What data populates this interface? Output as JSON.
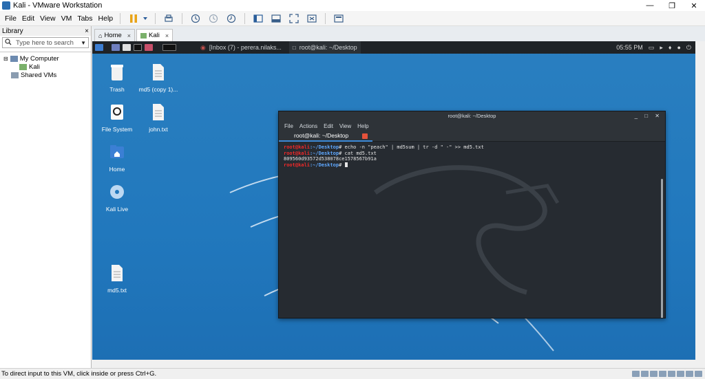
{
  "window": {
    "title": "Kali - VMware Workstation",
    "controls": [
      "—",
      "❐",
      "✕"
    ]
  },
  "menubar": {
    "items": [
      "File",
      "Edit",
      "View",
      "VM",
      "Tabs",
      "Help"
    ]
  },
  "library": {
    "title": "Library",
    "close": "×",
    "search_placeholder": "Type here to search",
    "tree": [
      {
        "label": "My Computer"
      },
      {
        "label": "Kali"
      },
      {
        "label": "Shared VMs"
      }
    ]
  },
  "tabs": [
    {
      "label": "Home",
      "close": "×"
    },
    {
      "label": "Kali",
      "close": "×"
    }
  ],
  "kali_panel": {
    "tasks": [
      "[Inbox (7) - perera.nilaks...",
      "root@kali: ~/Desktop"
    ],
    "clock": "05:55 PM"
  },
  "desktop_icons": [
    {
      "label": "Trash"
    },
    {
      "label": "md5 (copy 1)..."
    },
    {
      "label": "File System"
    },
    {
      "label": "john.txt"
    },
    {
      "label": "Home"
    },
    {
      "label": "Kali Live"
    },
    {
      "label": "md5.txt"
    }
  ],
  "terminal": {
    "title": "root@kali: ~/Desktop",
    "menu": [
      "File",
      "Actions",
      "Edit",
      "View",
      "Help"
    ],
    "tab_label": "root@kali: ~/Desktop",
    "prompt_user": "root@kali",
    "prompt_path": ":~/Desktop",
    "lines": [
      {
        "cmd": "# echo -n \"peach\" | md5sum | tr -d \" -\" >> md5.txt"
      },
      {
        "cmd": "# cat md5.txt"
      },
      {
        "output": "809560d93572d538078ce1578567b91a"
      },
      {
        "cmd": "# "
      }
    ]
  },
  "statusbar": {
    "text": "To direct input to this VM, click inside or press Ctrl+G."
  },
  "colors": {
    "desktop": "#2178bd",
    "terminal_bg": "#262b31",
    "prompt_user": "#ef2929",
    "prompt_path": "#5fa8ff"
  }
}
